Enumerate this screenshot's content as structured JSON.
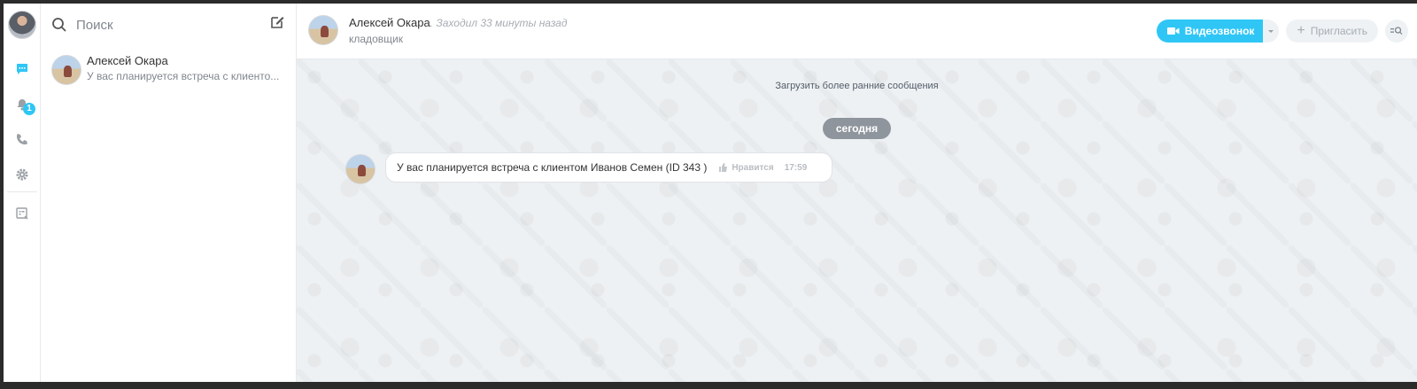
{
  "search": {
    "placeholder": "Поиск"
  },
  "recent": [
    {
      "name": "Алексей Окара",
      "preview": "У вас планируется встреча с клиенто..."
    }
  ],
  "rail": {
    "notifications_count": "1"
  },
  "chat": {
    "user_name": "Алексей Окара",
    "last_seen": ". Заходил 33 минуты назад",
    "position": "кладовщик",
    "video_label": "Видеозвонок",
    "invite_label": "Пригласить",
    "load_earlier": "Загрузить более ранние сообщения",
    "date_label": "сегодня",
    "messages": [
      {
        "text": "У вас планируется встреча с клиентом Иванов Семен (ID 343 )",
        "like_label": "Нравится",
        "time": "17:59"
      }
    ]
  },
  "colors": {
    "accent": "#2fc6f6",
    "pill": "#8f959d",
    "chat_bg": "#eef1f3"
  }
}
